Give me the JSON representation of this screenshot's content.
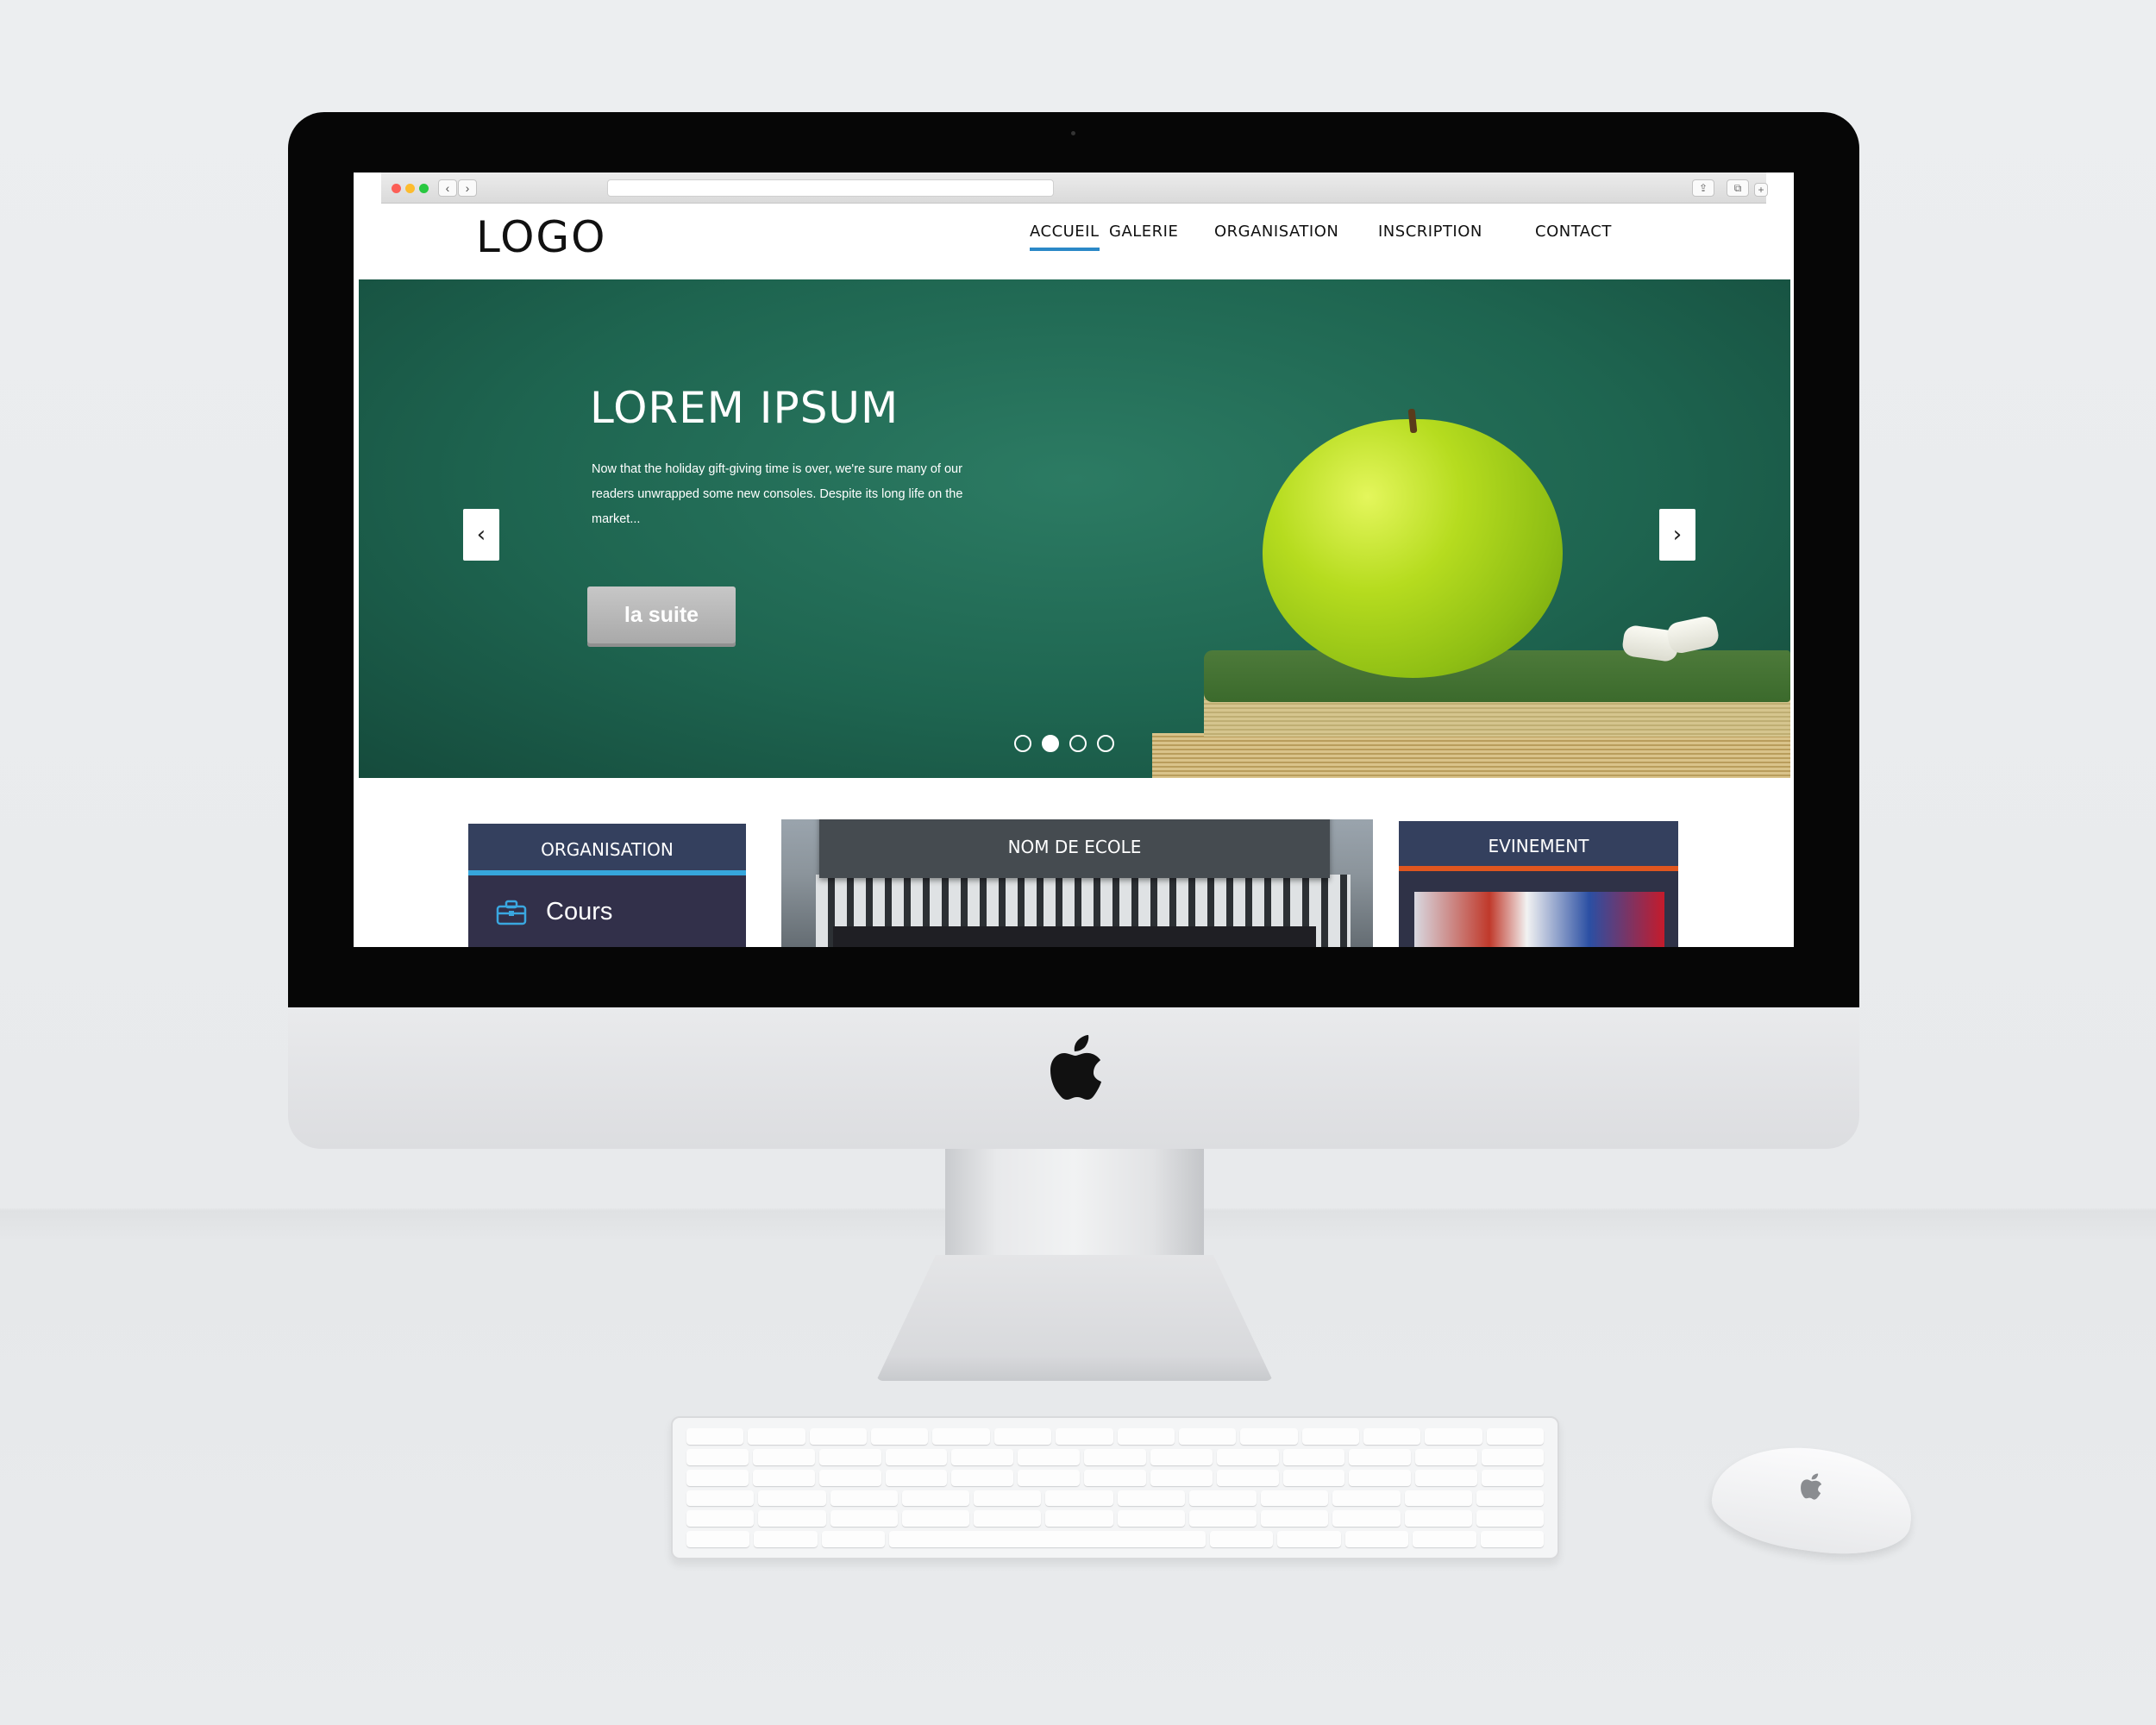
{
  "browser": {
    "back_label": "‹",
    "forward_label": "›",
    "share_label": "⇪",
    "tabs_label": "⧉",
    "add_tab_label": "+"
  },
  "site": {
    "logo": "LOGO",
    "nav": [
      "ACCUEIL",
      "GALERIE",
      "ORGANISATION",
      "INSCRIPTION",
      "CONTACT"
    ],
    "active_nav": "ACCUEIL",
    "accent_color": "#2b88c7"
  },
  "hero": {
    "title": "LOREM IPSUM",
    "text": "Now that the holiday gift-giving time is over, we're sure many of our readers unwrapped some new consoles. Despite its long life on the market...",
    "button_label": "la suite",
    "prev_arrow": "‹",
    "next_arrow": "›",
    "slides_count": 4,
    "active_slide": 2
  },
  "panels": {
    "organisation": {
      "title": "ORGANISATION",
      "item_label": "Cours",
      "accent_color": "#36a6dc"
    },
    "ecole": {
      "title": "NOM DE ECOLE"
    },
    "evenement": {
      "title": "EVINEMENT",
      "accent_color": "#e0561f"
    }
  },
  "icons": {
    "device_logo": "apple-logo-icon",
    "cours_icon": "toolbox-icon"
  }
}
